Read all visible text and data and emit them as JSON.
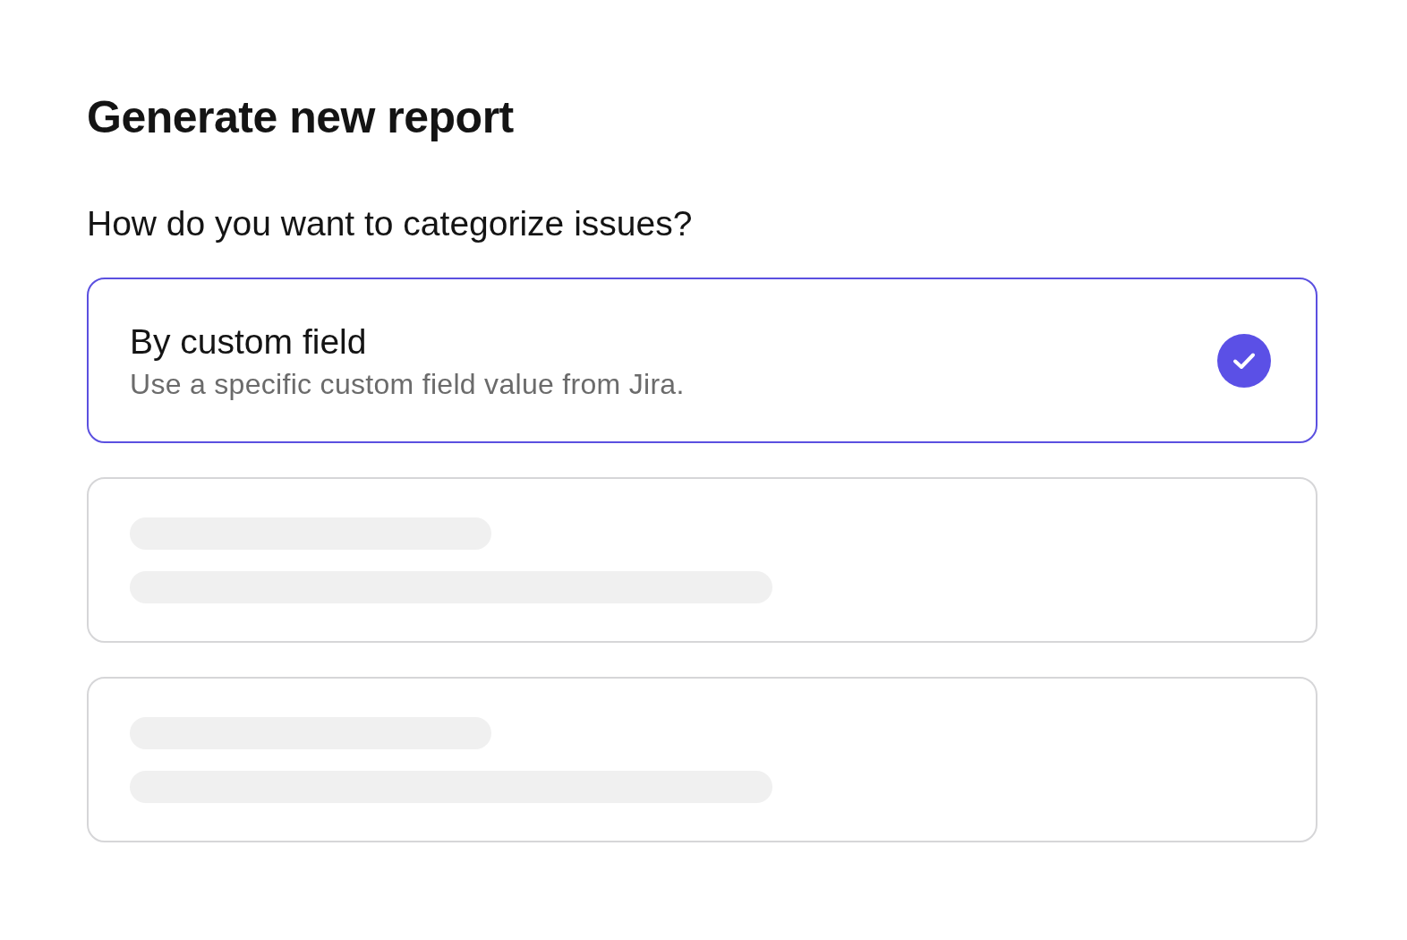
{
  "title": "Generate new report",
  "question": "How do you want to categorize issues?",
  "options": [
    {
      "kind": "option",
      "title": "By custom field",
      "description": "Use a specific custom field value from Jira.",
      "selected": true
    },
    {
      "kind": "skeleton",
      "selected": false
    },
    {
      "kind": "skeleton",
      "selected": false
    }
  ]
}
